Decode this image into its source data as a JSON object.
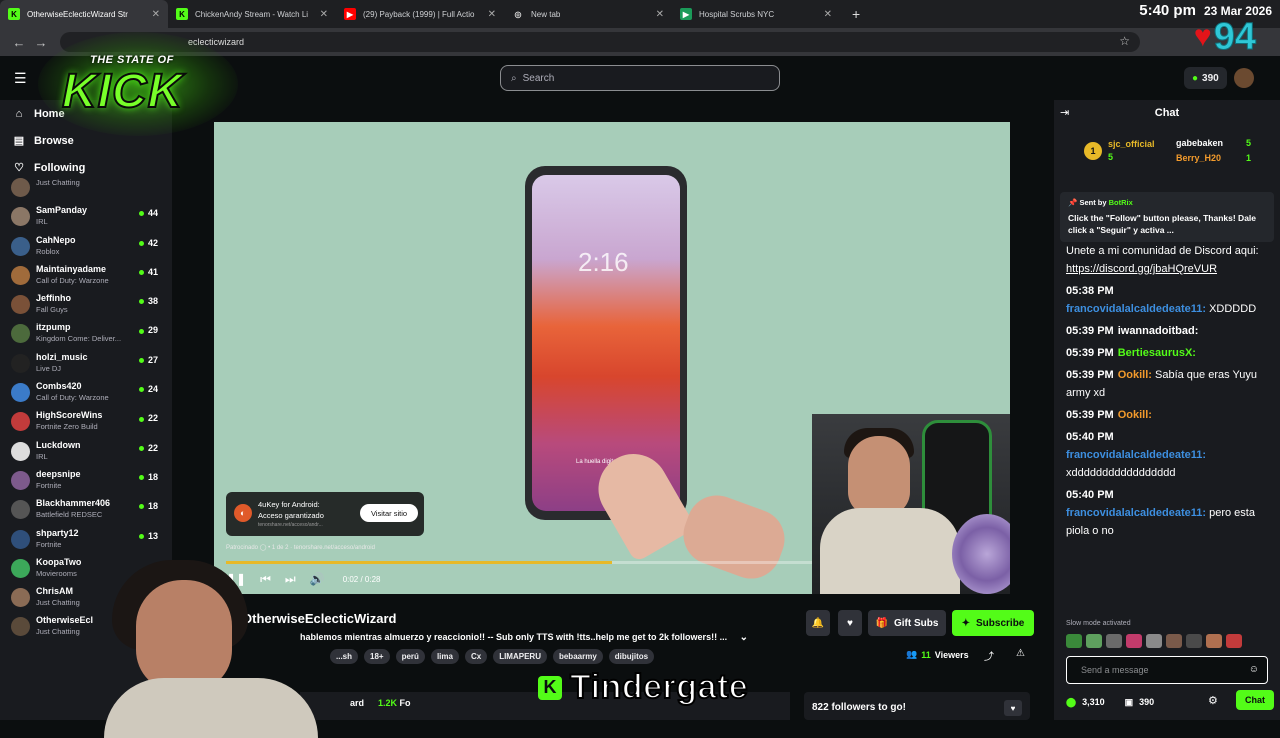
{
  "browser": {
    "tabs": [
      {
        "label": "OtherwiseEclecticWizard Str",
        "color": "#53fc18",
        "icon": "K"
      },
      {
        "label": "ChickenAndy Stream - Watch Li",
        "color": "#53fc18",
        "icon": "K"
      },
      {
        "label": "(29) Payback (1999) | Full Actio",
        "color": "#ff0000",
        "icon": "▶"
      },
      {
        "label": "New tab",
        "color": "#35363a",
        "icon": "◎"
      },
      {
        "label": "Hospital Scrubs NYC",
        "color": "#1b9a59",
        "icon": "▶"
      }
    ],
    "address": "eclecticwizard",
    "clock_time": "5:40 pm",
    "clock_date": "23 Mar 2026",
    "overlay_number": "94"
  },
  "overlay": {
    "logo_top": "THE STATE OF",
    "logo_main": "KICK",
    "caption_icon": "K",
    "caption": "Tindergate"
  },
  "header": {
    "search_placeholder": "Search",
    "points": "390"
  },
  "sidebar": {
    "nav": [
      {
        "icon": "⌂",
        "label": "Home"
      },
      {
        "icon": "▤",
        "label": "Browse"
      },
      {
        "icon": "♡",
        "label": "Following"
      }
    ],
    "channels": [
      {
        "name": "",
        "game": "Just Chatting",
        "count": "",
        "color": "#6e5a4a"
      },
      {
        "name": "SamPanday",
        "game": "IRL",
        "count": "44",
        "color": "#8b7766"
      },
      {
        "name": "CahNepo",
        "game": "Roblox",
        "count": "42",
        "color": "#3a5f8a"
      },
      {
        "name": "Maintainyadame",
        "game": "Call of Duty: Warzone",
        "count": "41",
        "color": "#a06b3b"
      },
      {
        "name": "Jeffinho",
        "game": "Fall Guys",
        "count": "38",
        "color": "#7a5138"
      },
      {
        "name": "itzpump",
        "game": "Kingdom Come: Deliver...",
        "count": "29",
        "color": "#4c6a3c"
      },
      {
        "name": "holzi_music",
        "game": "Live DJ",
        "count": "27",
        "color": "#222222"
      },
      {
        "name": "Combs420",
        "game": "Call of Duty: Warzone",
        "count": "24",
        "color": "#3b7bc8"
      },
      {
        "name": "HighScoreWins",
        "game": "Fortnite Zero Build",
        "count": "22",
        "color": "#c23b3b"
      },
      {
        "name": "Luckdown",
        "game": "IRL",
        "count": "22",
        "color": "#dddddd"
      },
      {
        "name": "deepsnipe",
        "game": "Fortnite",
        "count": "18",
        "color": "#7d5a8c"
      },
      {
        "name": "Blackhammer406",
        "game": "Battlefield REDSEC",
        "count": "18",
        "color": "#555555"
      },
      {
        "name": "shparty12",
        "game": "Fortnite",
        "count": "13",
        "color": "#2f4f7a"
      },
      {
        "name": "KoopaTwo",
        "game": "Movierooms",
        "count": "",
        "color": "#3ca85a"
      },
      {
        "name": "ChrisAM",
        "game": "Just Chatting",
        "count": "",
        "color": "#8a6b55"
      },
      {
        "name": "OtherwiseEcl",
        "game": "Just Chatting",
        "count": "",
        "color": "#5a4a3a"
      }
    ]
  },
  "video": {
    "phone_time": "2:16",
    "phone_hint": "La huella digital no coincide",
    "ad_title": "4uKey for Android:",
    "ad_subtitle": "Acceso garantizado",
    "ad_url": "tenorshare.net/acceso/andr...",
    "ad_button": "Visitar sitio",
    "sponsored": "Patrocinado  ◯ • 1 de 2  ·  tenorshare.net/acceso/android",
    "time": "0:02 / 0:28",
    "progress": 0.5
  },
  "stream": {
    "channel": "OtherwiseEclecticWizard",
    "title": "hablemos mientras almuerzo y reaccionio!! -- Sub only TTS with !tts..help me get to 2k followers!! ...",
    "tags": [
      "...sh",
      "18+",
      "perú",
      "lima",
      "Cx",
      "LIMAPERU",
      "bebaarmy",
      "dibujitos"
    ],
    "gift_subs": "Gift Subs",
    "subscribe": "Subscribe",
    "viewers_count": "11",
    "viewers_label": "Viewers",
    "followers_goal": "822 followers to go!",
    "profile_name": "ard",
    "profile_followers": "1.2K",
    "profile_followers_suffix": "Fo"
  },
  "chat": {
    "title": "Chat",
    "gifters": [
      {
        "name": "sjc_official",
        "count": "5"
      },
      {
        "name": "gabebaken",
        "count": "5"
      },
      {
        "name": "Berry_H20",
        "count": "1"
      }
    ],
    "pinned_sent_by": "Sent by",
    "pinned_bot": "BotRix",
    "pinned_text": "Click the \"Follow\" button please, Thanks! Dale click a \"Seguir\" y activa ...",
    "messages": [
      {
        "time": "",
        "user": "",
        "text": "Unete a mi comunidad de Discord aqui:",
        "link": "https://discord.gg/jbaHQreVUR"
      },
      {
        "time": "05:38 PM",
        "user": "francovidalalcaldedeate11:",
        "text": "XDDDDD",
        "link": ""
      },
      {
        "time": "05:39 PM",
        "user": "iwannadoitbad:",
        "text": "",
        "link": ""
      },
      {
        "time": "05:39 PM",
        "user": "BertiesaurusX:",
        "text": "",
        "link": ""
      },
      {
        "time": "05:39 PM",
        "user": "Ookill:",
        "text": "Sabía que eras Yuyu army xd",
        "link": ""
      },
      {
        "time": "05:39 PM",
        "user": "Ookill:",
        "text": "",
        "link": ""
      },
      {
        "time": "05:40 PM",
        "user": "francovidalalcaldedeate11:",
        "text": "xddddddddddddddddd",
        "link": ""
      },
      {
        "time": "05:40 PM",
        "user": "francovidalalcaldedeate11:",
        "text": "pero esta piola o no",
        "link": ""
      }
    ],
    "slow_mode": "Slow mode activated",
    "input_placeholder": "Send a message",
    "kick_points": "3,310",
    "gift_points": "390",
    "chat_button": "Chat"
  }
}
